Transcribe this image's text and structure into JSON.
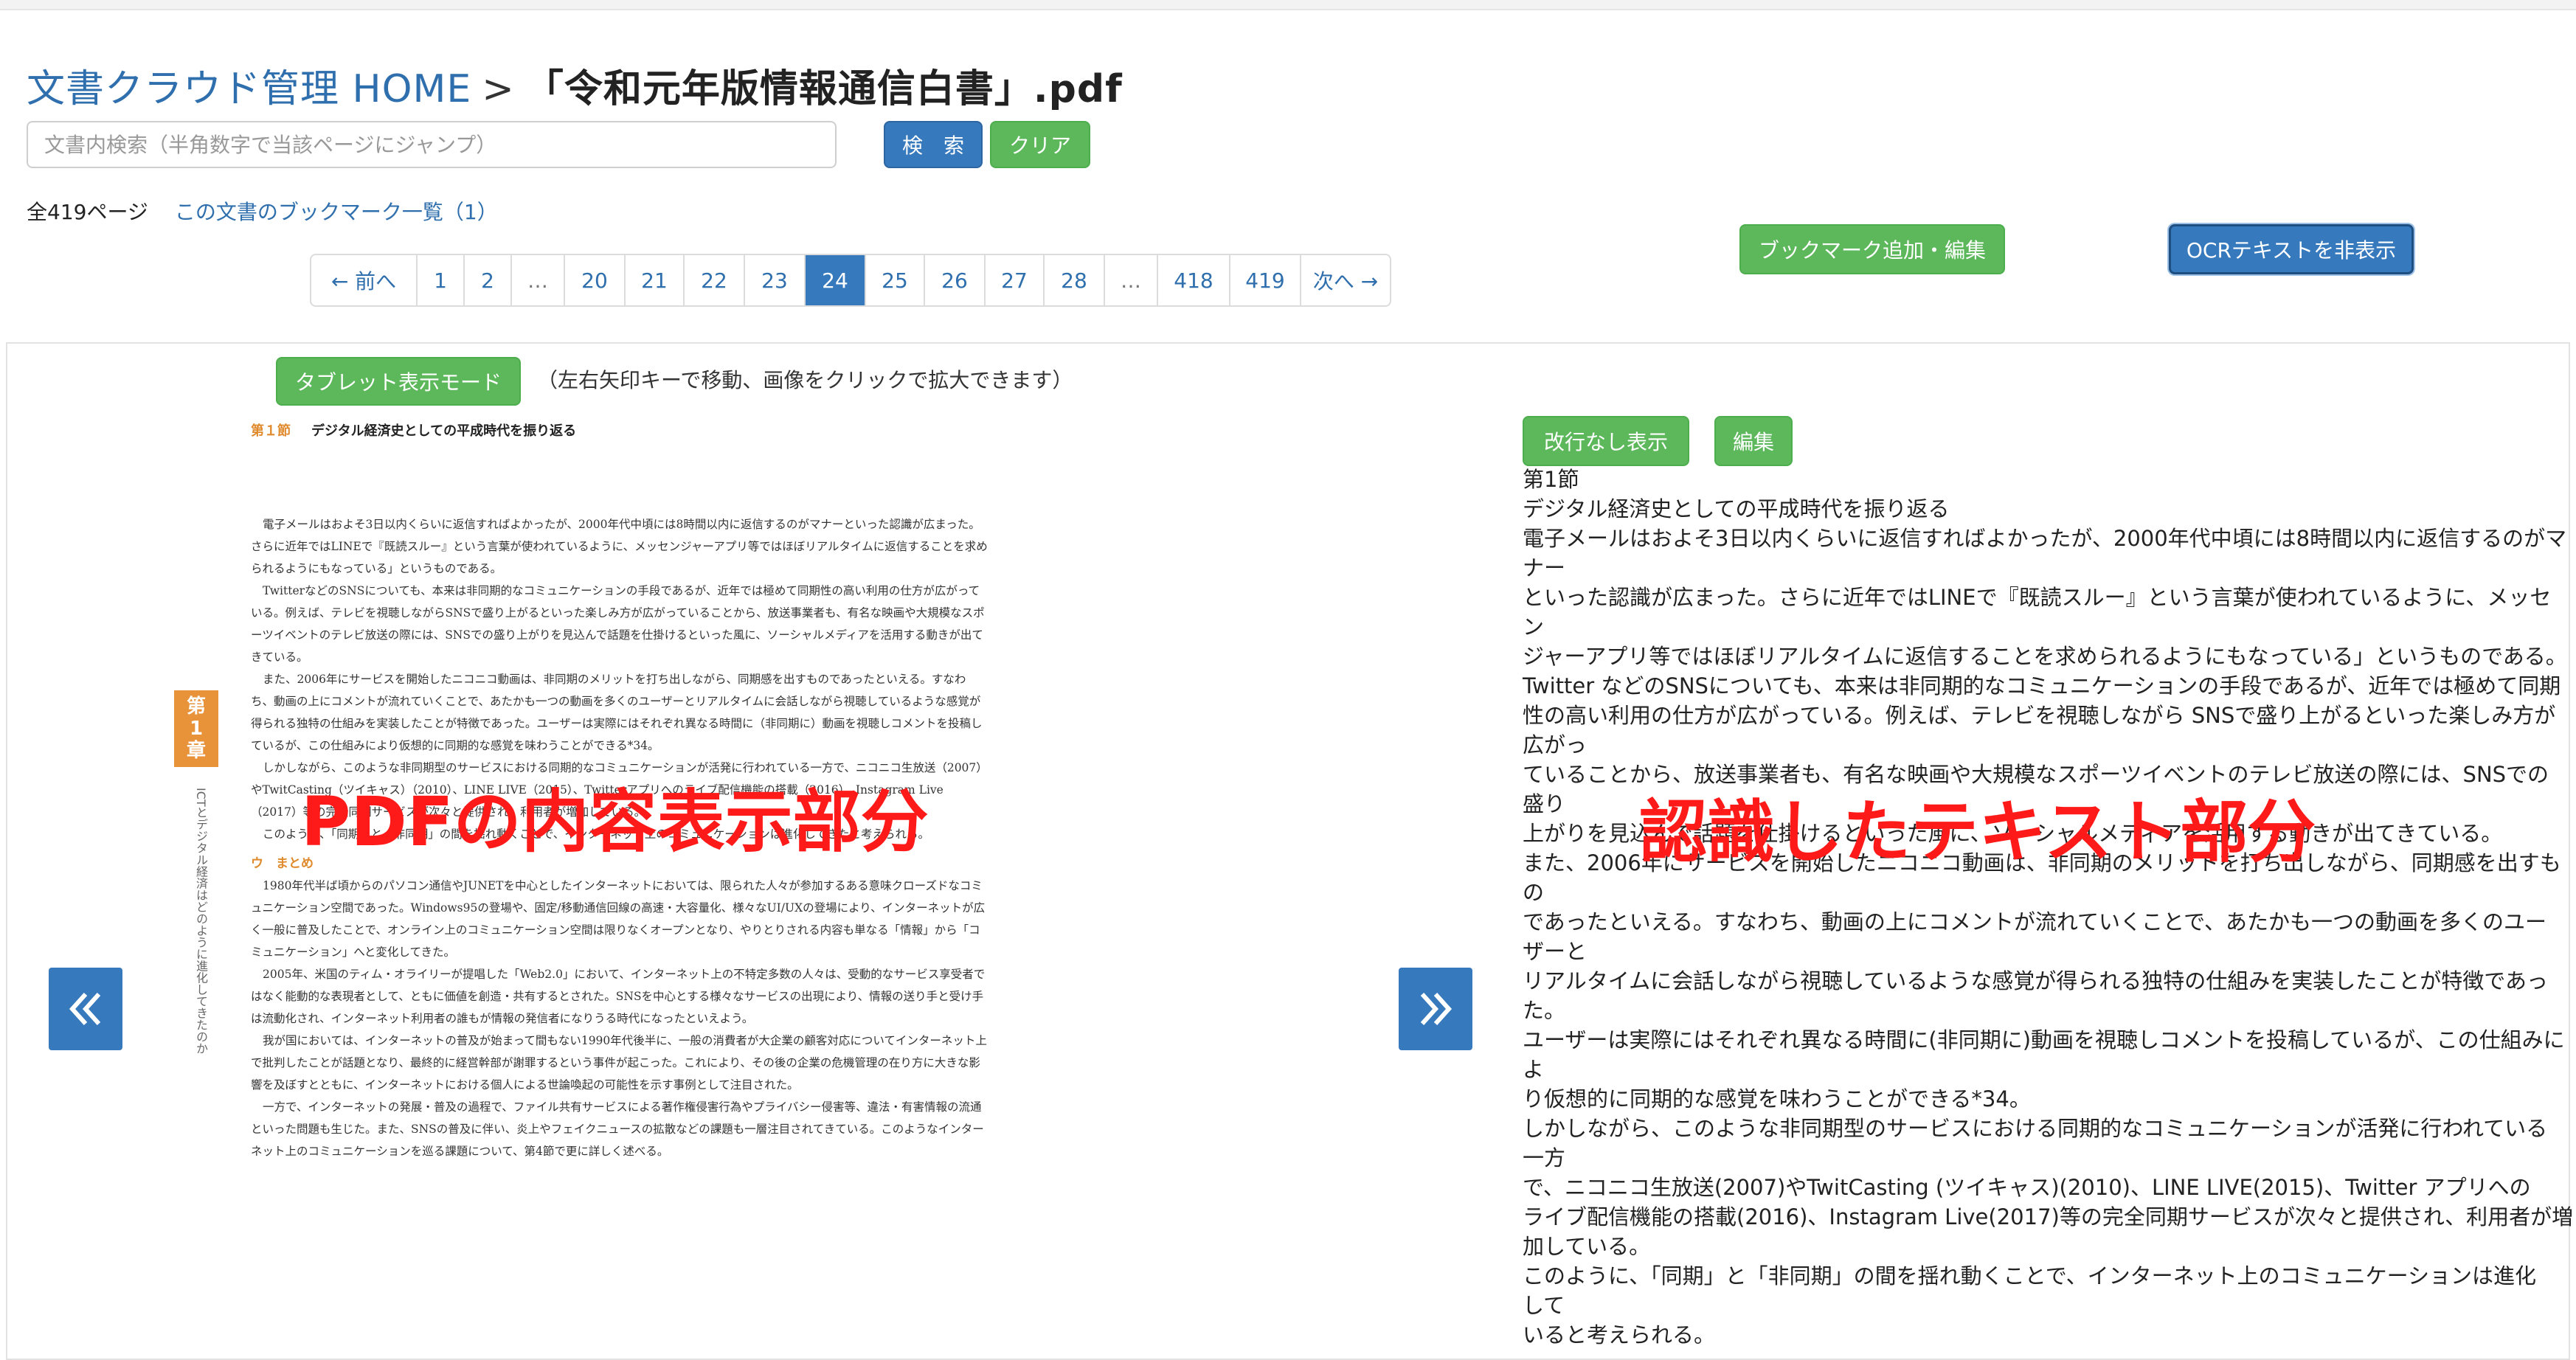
{
  "breadcrumb": {
    "home": "文書クラウド管理 HOME",
    "separator": ">",
    "file": "「令和元年版情報通信白書」.pdf"
  },
  "search": {
    "placeholder": "文書内検索（半角数字で当該ページにジャンプ）",
    "search_label": "検　索",
    "clear_label": "クリア"
  },
  "info": {
    "page_count": "全419ページ",
    "bookmarks_link": "この文書のブックマーク一覧（1）"
  },
  "actions": {
    "bookmark_label": "ブックマーク追加・編集",
    "ocr_toggle_label": "OCRテキストを非表示"
  },
  "pagination": {
    "prev": "← 前へ",
    "next": "次へ →",
    "pages": [
      "1",
      "2",
      "…",
      "20",
      "21",
      "22",
      "23",
      "24",
      "25",
      "26",
      "27",
      "28",
      "…",
      "418",
      "419"
    ],
    "current": "24"
  },
  "viewer": {
    "tablet_mode_label": "タブレット表示モード",
    "hint": "（左右矢印キーで移動、画像をクリックで拡大できます）"
  },
  "pdf_page": {
    "section": "第１節",
    "title": "デジタル経済史としての平成時代を振り返る",
    "chapter_tab": [
      "第",
      "1",
      "章"
    ],
    "chapter_vertical": "ICTとデジタル経済はどのように進化してきたのか",
    "paragraphs": [
      "電子メールはおよそ3日以内くらいに返信すればよかったが、2000年代中頃には8時間以内に返信するのがマナーといった認識が広まった。さらに近年ではLINEで『既読スルー』という言葉が使われているように、メッセンジャーアプリ等ではほぼリアルタイムに返信することを求められるようにもなっている」というものである。",
      "TwitterなどのSNSについても、本来は非同期的なコミュニケーションの手段であるが、近年では極めて同期性の高い利用の仕方が広がっている。例えば、テレビを視聴しながらSNSで盛り上がるといった楽しみ方が広がっていることから、放送事業者も、有名な映画や大規模なスポーツイベントのテレビ放送の際には、SNSでの盛り上がりを見込んで話題を仕掛けるといった風に、ソーシャルメディアを活用する動きが出てきている。",
      "また、2006年にサービスを開始したニコニコ動画は、非同期のメリットを打ち出しながら、同期感を出すものであったといえる。すなわち、動画の上にコメントが流れていくことで、あたかも一つの動画を多くのユーザーとリアルタイムに会話しながら視聴しているような感覚が得られる独特の仕組みを実装したことが特徴であった。ユーザーは実際にはそれぞれ異なる時間に（非同期に）動画を視聴しコメントを投稿しているが、この仕組みにより仮想的に同期的な感覚を味わうことができる*34。",
      "しかしながら、このような非同期型のサービスにおける同期的なコミュニケーションが活発に行われている一方で、ニコニコ生放送（2007）やTwitCasting（ツイキャス）（2010）、LINE LIVE（2015）、Twitterアプリへのライブ配信機能の搭載（2016）、Instagram Live（2017）等の完全同期サービスが次々と提供され、利用者が増加している。",
      "このように、「同期」と「非同期」の間を揺れ動くことで、インターネット上のコミュニケーションは進化してきたと考えられる。"
    ],
    "subheading": "ウ　まとめ",
    "paragraphs2": [
      "1980年代半ば頃からのパソコン通信やJUNETを中心としたインターネットにおいては、限られた人々が参加するある意味クローズドなコミュニケーション空間であった。Windows95の登場や、固定/移動通信回線の高速・大容量化、様々なUI/UXの登場により、インターネットが広く一般に普及したことで、オンライン上のコミュニケーション空間は限りなくオープンとなり、やりとりされる内容も単なる「情報」から「コミュニケーション」へと変化してきた。",
      "2005年、米国のティム・オライリーが提唱した「Web2.0」において、インターネット上の不特定多数の人々は、受動的なサービス享受者ではなく能動的な表現者として、ともに価値を創造・共有するとされた。SNSを中心とする様々なサービスの出現により、情報の送り手と受け手は流動化され、インターネット利用者の誰もが情報の発信者になりうる時代になったといえよう。",
      "我が国においては、インターネットの普及が始まって間もない1990年代後半に、一般の消費者が大企業の顧客対応についてインターネット上で批判したことが話題となり、最終的に経営幹部が謝罪するという事件が起こった。これにより、その後の企業の危機管理の在り方に大きな影響を及ぼすとともに、インターネットにおける個人による世論喚起の可能性を示す事例として注目された。",
      "一方で、インターネットの発展・普及の過程で、ファイル共有サービスによる著作権侵害行為やプライバシー侵害等、違法・有害情報の流通といった問題も生じた。また、SNSの普及に伴い、炎上やフェイクニュースの拡散などの課題も一層注目されてきている。このようなインターネット上のコミュニケーションを巡る課題について、第4節で更に詳しく述べる。"
    ]
  },
  "ocr": {
    "no_break_label": "改行なし表示",
    "edit_label": "編集",
    "lines": [
      "第1節",
      "デジタル経済史としての平成時代を振り返る",
      "電子メールはおよそ3日以内くらいに返信すればよかったが、2000年代中頃には8時間以内に返信するのがマ",
      "ナー",
      "といった認識が広まった。さらに近年ではLINEで『既読スルー』という言葉が使われているように、メッセ",
      "ン",
      "ジャーアプリ等ではほぼリアルタイムに返信することを求められるようにもなっている」というものである。",
      "Twitter などのSNSについても、本来は非同期的なコミュニケーションの手段であるが、近年では極めて同期",
      "性の高い利用の仕方が広がっている。例えば、テレビを視聴しながら SNSで盛り上がるといった楽しみ方が",
      "広がっ",
      "ていることから、放送事業者も、有名な映画や大規模なスポーツイベントのテレビ放送の際には、SNSでの",
      "盛り",
      "上がりを見込んで話題を仕掛けるといった風に、ソーシャルメディアを活用する動きが出てきている。",
      "また、2006年にサービスを開始したニコニコ動画は、非同期のメリットを打ち出しながら、同期感を出すも",
      "の",
      "であったといえる。すなわち、動画の上にコメントが流れていくことで、あたかも一つの動画を多くのユー",
      "ザーと",
      "リアルタイムに会話しながら視聴しているような感覚が得られる独特の仕組みを実装したことが特徴であっ",
      "た。",
      "ユーザーは実際にはそれぞれ異なる時間に(非同期に)動画を視聴しコメントを投稿しているが、この仕組みに",
      "よ",
      "り仮想的に同期的な感覚を味わうことができる*34。",
      "しかしながら、このような非同期型のサービスにおける同期的なコミュニケーションが活発に行われている",
      "一方",
      "で、ニコニコ生放送(2007)やTwitCasting (ツイキャス)(2010)、LINE LIVE(2015)、Twitter アプリへの",
      "ライブ配信機能の搭載(2016)、Instagram Live(2017)等の完全同期サービスが次々と提供され、利用者が増",
      "加している。",
      "このように、「同期」と「非同期」の間を揺れ動くことで、インターネット上のコミュニケーションは進化",
      "して",
      "いると考えられる。"
    ]
  },
  "annotations": {
    "left_label": "PDFの内容表示部分",
    "right_label": "認識したテキスト部分"
  },
  "colors": {
    "primary": "#3679bd",
    "success": "#5db85c",
    "annotation": "#ff1a1a",
    "section_orange": "#e08a2e"
  },
  "icons": {
    "prev_page": "double-chevron-left-icon",
    "next_page": "double-chevron-right-icon"
  }
}
